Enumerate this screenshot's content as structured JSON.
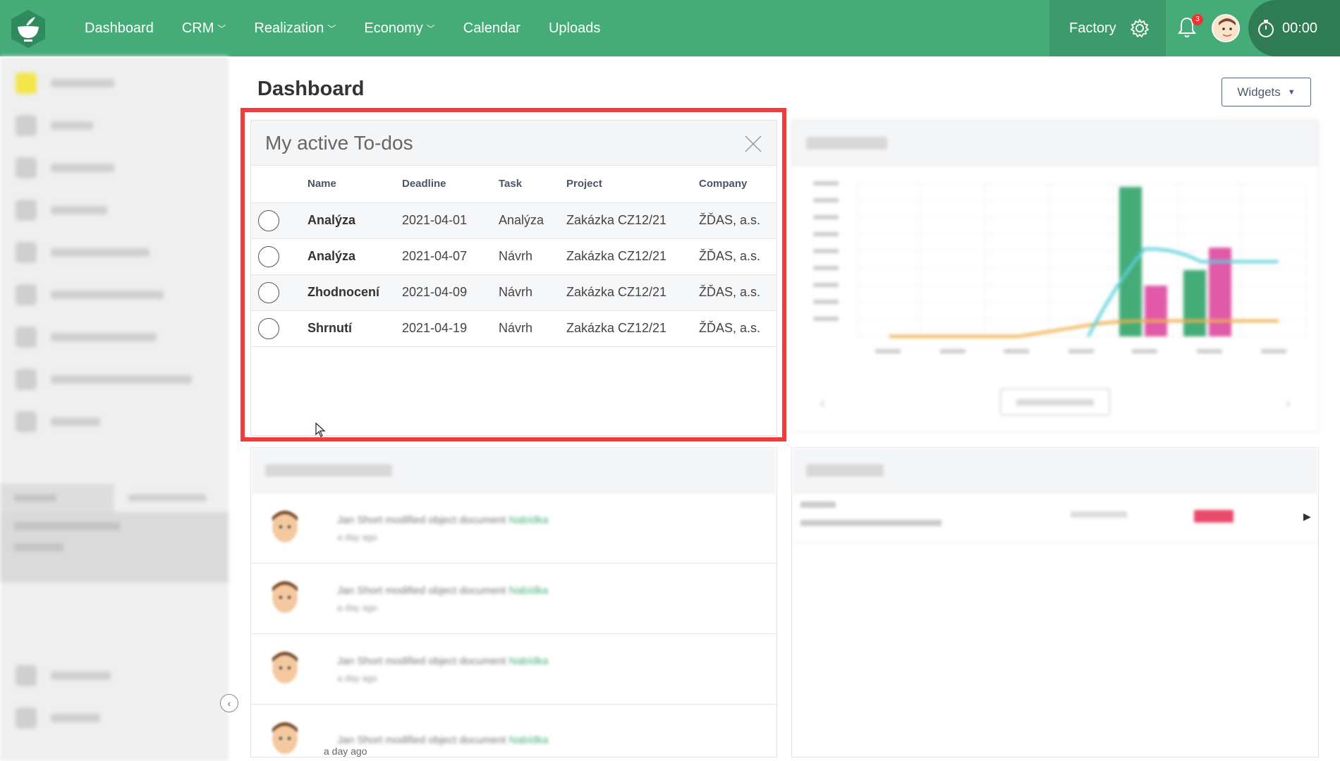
{
  "topbar": {
    "nav": [
      {
        "label": "Dashboard",
        "has_dropdown": false
      },
      {
        "label": "CRM",
        "has_dropdown": true
      },
      {
        "label": "Realization",
        "has_dropdown": true
      },
      {
        "label": "Economy",
        "has_dropdown": true
      },
      {
        "label": "Calendar",
        "has_dropdown": false
      },
      {
        "label": "Uploads",
        "has_dropdown": false
      }
    ],
    "factory_label": "Factory",
    "notification_count": "3",
    "timer": "00:00",
    "accent": "#45ac78"
  },
  "page": {
    "title": "Dashboard",
    "widgets_button": "Widgets"
  },
  "todos": {
    "title": "My active To-dos",
    "columns": [
      "Name",
      "Deadline",
      "Task",
      "Project",
      "Company"
    ],
    "rows": [
      {
        "name": "Analýza",
        "deadline": "2021-04-01",
        "task": "Analýza",
        "project": "Zakázka CZ12/21",
        "company": "ŽĎAS, a.s."
      },
      {
        "name": "Analýza",
        "deadline": "2021-04-07",
        "task": "Návrh",
        "project": "Zakázka CZ12/21",
        "company": "ŽĎAS, a.s."
      },
      {
        "name": "Zhodnocení",
        "deadline": "2021-04-09",
        "task": "Návrh",
        "project": "Zakázka CZ12/21",
        "company": "ŽĎAS, a.s."
      },
      {
        "name": "Shrnutí",
        "deadline": "2021-04-19",
        "task": "Návrh",
        "project": "Zakázka CZ12/21",
        "company": "ŽĎAS, a.s."
      }
    ]
  },
  "recent_activity": {
    "last_time": "a day ago"
  }
}
